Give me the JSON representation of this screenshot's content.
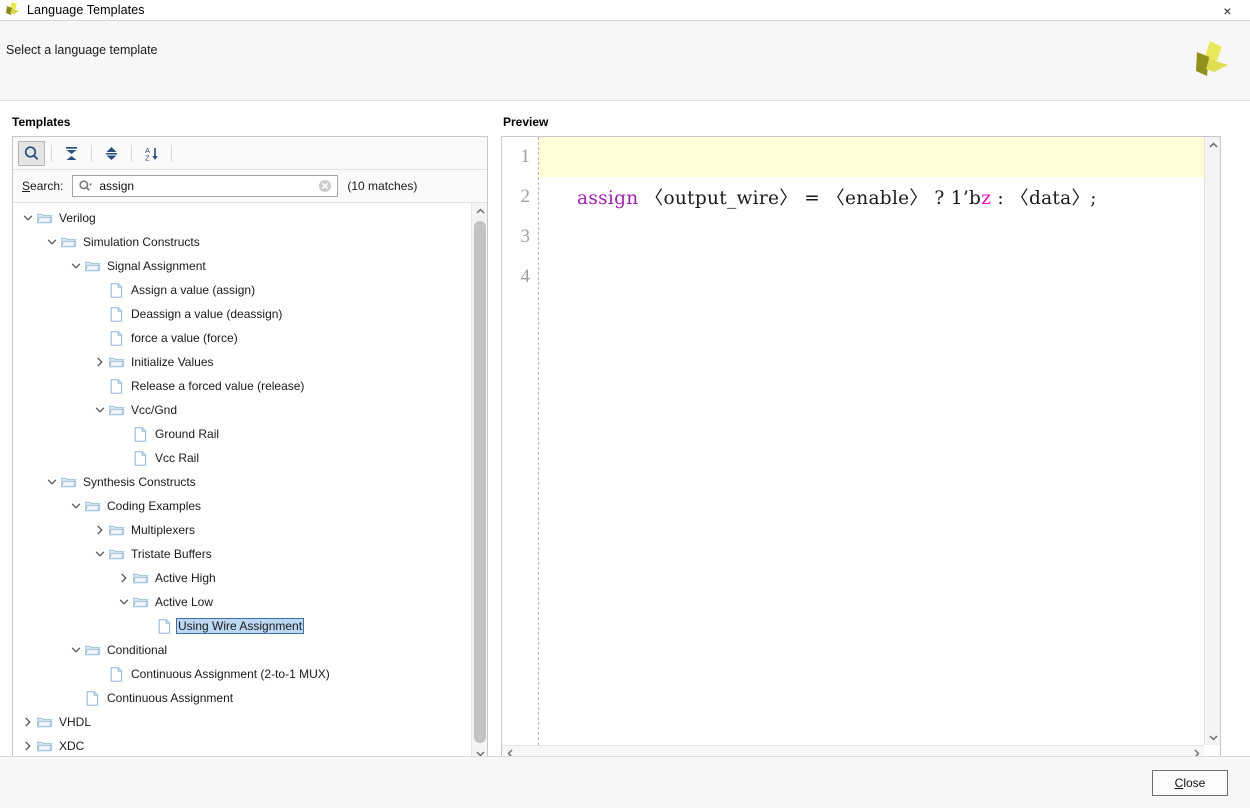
{
  "window": {
    "title": "Language Templates",
    "app_icon": "vivado-logo-icon",
    "close_icon": "×"
  },
  "header": {
    "instruction": "Select a language template",
    "logo": "xilinx-logo-icon"
  },
  "templates": {
    "label": "Templates",
    "toolbar": [
      {
        "name": "search-toggle-button",
        "icon": "magnifier-icon",
        "active": true
      },
      {
        "name": "collapse-all-button",
        "icon": "collapse-all-icon",
        "active": false
      },
      {
        "name": "expand-all-button",
        "icon": "expand-all-icon",
        "active": false
      },
      {
        "name": "sort-az-button",
        "icon": "sort-alpha-icon",
        "active": false
      }
    ],
    "search": {
      "label": "Search:",
      "mnemonic": "S",
      "rest": "earch:",
      "value": "assign",
      "placeholder": "",
      "clear_icon": "clear-circle-icon",
      "prefix_icon": "magnifier-dropdown-icon",
      "matches": "(10 matches)"
    },
    "tree": [
      {
        "label": "Verilog",
        "depth": 0,
        "type": "folder",
        "state": "expanded",
        "selected": false
      },
      {
        "label": "Simulation Constructs",
        "depth": 1,
        "type": "folder",
        "state": "expanded",
        "selected": false
      },
      {
        "label": "Signal Assignment",
        "depth": 2,
        "type": "folder",
        "state": "expanded",
        "selected": false
      },
      {
        "label": "Assign a value (assign)",
        "depth": 3,
        "type": "file",
        "state": "leaf",
        "selected": false
      },
      {
        "label": "Deassign a value (deassign)",
        "depth": 3,
        "type": "file",
        "state": "leaf",
        "selected": false
      },
      {
        "label": "force a value (force)",
        "depth": 3,
        "type": "file",
        "state": "leaf",
        "selected": false
      },
      {
        "label": "Initialize Values",
        "depth": 3,
        "type": "folder",
        "state": "collapsed",
        "selected": false
      },
      {
        "label": "Release a forced value (release)",
        "depth": 3,
        "type": "file",
        "state": "leaf",
        "selected": false
      },
      {
        "label": "Vcc/Gnd",
        "depth": 3,
        "type": "folder",
        "state": "expanded",
        "selected": false
      },
      {
        "label": "Ground Rail",
        "depth": 4,
        "type": "file",
        "state": "leaf",
        "selected": false
      },
      {
        "label": "Vcc Rail",
        "depth": 4,
        "type": "file",
        "state": "leaf",
        "selected": false
      },
      {
        "label": "Synthesis Constructs",
        "depth": 1,
        "type": "folder",
        "state": "expanded",
        "selected": false
      },
      {
        "label": "Coding Examples",
        "depth": 2,
        "type": "folder",
        "state": "expanded",
        "selected": false
      },
      {
        "label": "Multiplexers",
        "depth": 3,
        "type": "folder",
        "state": "collapsed",
        "selected": false
      },
      {
        "label": "Tristate Buffers",
        "depth": 3,
        "type": "folder",
        "state": "expanded",
        "selected": false
      },
      {
        "label": "Active High",
        "depth": 4,
        "type": "folder",
        "state": "collapsed",
        "selected": false
      },
      {
        "label": "Active Low",
        "depth": 4,
        "type": "folder",
        "state": "expanded",
        "selected": false
      },
      {
        "label": "Using Wire Assignment",
        "depth": 5,
        "type": "file",
        "state": "leaf",
        "selected": true
      },
      {
        "label": "Conditional",
        "depth": 2,
        "type": "folder",
        "state": "expanded",
        "selected": false
      },
      {
        "label": "Continuous Assignment (2-to-1 MUX)",
        "depth": 3,
        "type": "file",
        "state": "leaf",
        "selected": false
      },
      {
        "label": "Continuous Assignment",
        "depth": 2,
        "type": "file",
        "state": "leaf",
        "selected": false
      },
      {
        "label": "VHDL",
        "depth": 0,
        "type": "folder",
        "state": "collapsed",
        "selected": false
      },
      {
        "label": "XDC",
        "depth": 0,
        "type": "folder",
        "state": "collapsed",
        "selected": false
      }
    ]
  },
  "preview": {
    "label": "Preview",
    "lines": [
      {
        "number": "1",
        "highlighted": true,
        "tokens": []
      },
      {
        "number": "2",
        "highlighted": false,
        "tokens": [
          {
            "text": "assign",
            "cls": "tok-kw"
          },
          {
            "text": " 〈output_wire〉 = 〈enable〉 ? 1’b",
            "cls": "tok-plain"
          },
          {
            "text": "z",
            "cls": "tok-lit"
          },
          {
            "text": " : 〈data〉;",
            "cls": "tok-plain"
          }
        ]
      },
      {
        "number": "3",
        "highlighted": false,
        "tokens": []
      },
      {
        "number": "4",
        "highlighted": false,
        "tokens": []
      }
    ],
    "code_plain": "assign <output_wire> = <enable> ? 1'bz : <data>;",
    "highlight_color": "#ffffd8"
  },
  "footer": {
    "close_mnemonic": "C",
    "close_rest": "lose",
    "close_label": "Close"
  }
}
